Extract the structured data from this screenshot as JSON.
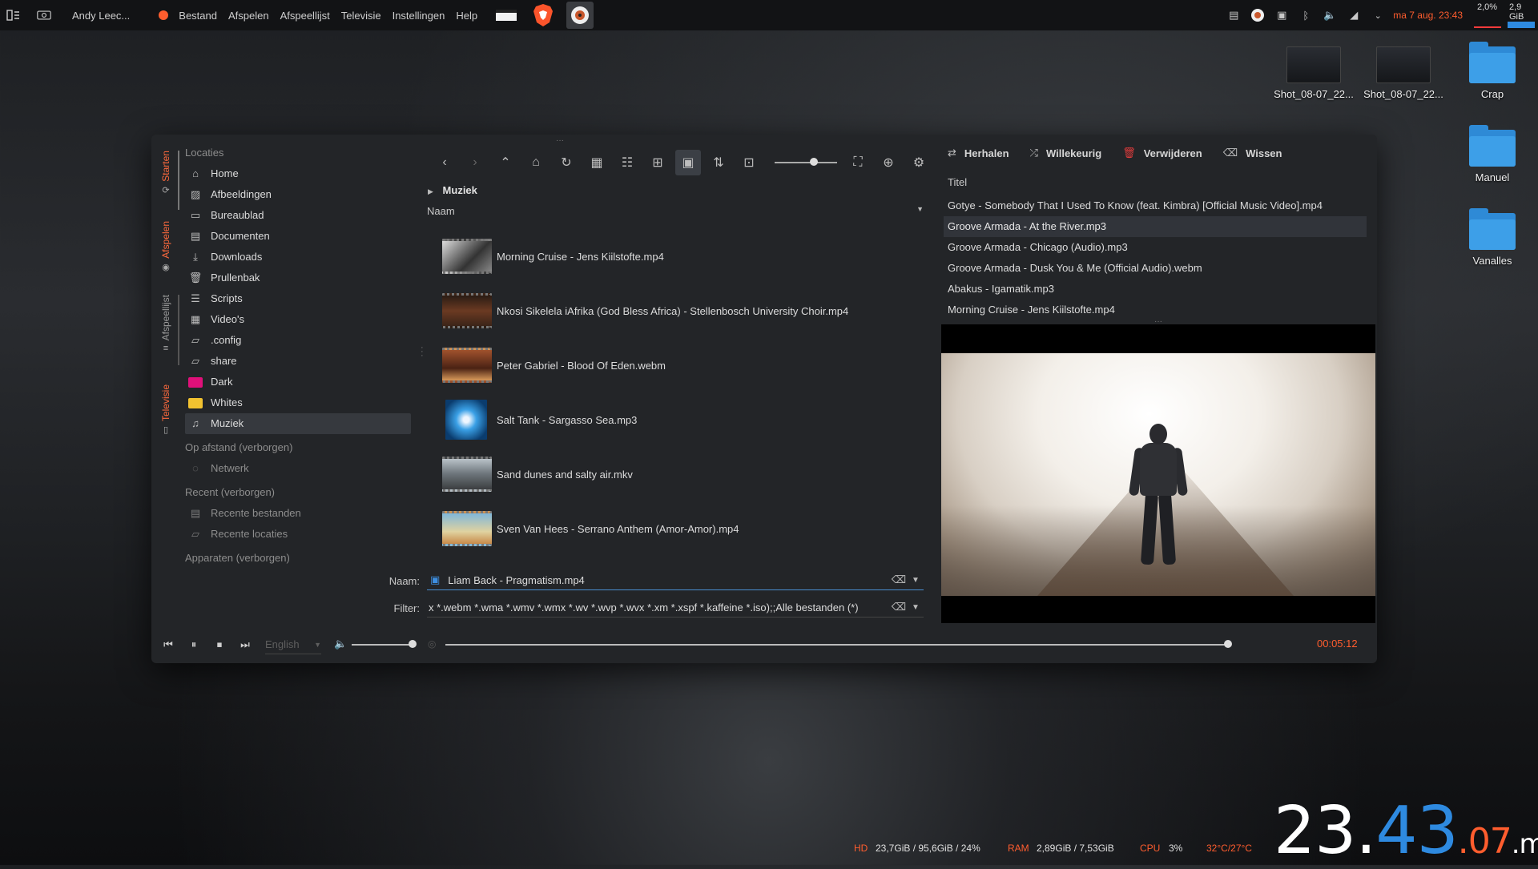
{
  "panel": {
    "user": "Andy Leec...",
    "menus": [
      "Bestand",
      "Afspelen",
      "Afspeellijst",
      "Televisie",
      "Instellingen",
      "Help"
    ],
    "datetime": "ma 7 aug. 23:43",
    "cpu_load": "2,0%",
    "mem_load": "2,9 GiB",
    "accent": "#ff5d2e"
  },
  "desktop": {
    "icons": [
      {
        "label": "Shot_08-07_22...",
        "type": "image"
      },
      {
        "label": "Shot_08-07_22...",
        "type": "image"
      },
      {
        "label": "Crap",
        "type": "folder"
      },
      {
        "label": "Manuel",
        "type": "folder"
      },
      {
        "label": "Vanalles",
        "type": "folder"
      }
    ]
  },
  "sidebar_tabs": [
    "Starten",
    "Afspelen",
    "Afspeellijst",
    "Televisie"
  ],
  "places": {
    "header": "Locaties",
    "items": [
      {
        "label": "Home",
        "icon": "home-icon"
      },
      {
        "label": "Afbeeldingen",
        "icon": "image-folder-icon"
      },
      {
        "label": "Bureaublad",
        "icon": "desktop-icon"
      },
      {
        "label": "Documenten",
        "icon": "document-icon"
      },
      {
        "label": "Downloads",
        "icon": "download-icon"
      },
      {
        "label": "Prullenbak",
        "icon": "trash-icon"
      },
      {
        "label": "Scripts",
        "icon": "script-icon"
      },
      {
        "label": "Video's",
        "icon": "video-icon"
      },
      {
        "label": ".config",
        "icon": "folder-icon"
      },
      {
        "label": "share",
        "icon": "folder-icon"
      },
      {
        "label": "Dark",
        "icon": "magenta-folder-icon"
      },
      {
        "label": "Whites",
        "icon": "yellow-folder-icon"
      },
      {
        "label": "Muziek",
        "icon": "music-icon",
        "selected": true
      }
    ],
    "remote_header": "Op afstand (verborgen)",
    "network": "Netwerk",
    "recent_header": "Recent (verborgen)",
    "recent_files": "Recente bestanden",
    "recent_locations": "Recente locaties",
    "devices_header": "Apparaten (verborgen)"
  },
  "browser": {
    "breadcrumb": "Muziek",
    "column": "Naam",
    "files": [
      "Morning Cruise - Jens Kiilstofte.mp4",
      "Nkosi Sikelela iAfrika (God Bless Africa) - Stellenbosch University Choir.mp4",
      "Peter Gabriel - Blood Of Eden.webm",
      "Salt Tank - Sargasso Sea.mp3",
      "Sand dunes and salty air.mkv",
      "Sven Van Hees - Serrano Anthem (Amor-Amor).mp4"
    ],
    "name_label": "Naam:",
    "name_value": "Liam Back - Pragmatism.mp4",
    "filter_label": "Filter:",
    "filter_value": "x *.webm *.wma *.wmv *.wmx *.wv *.wvp *.wvx *.xm *.xspf *.kaffeine *.iso);;Alle bestanden (*)"
  },
  "playlist": {
    "repeat": "Herhalen",
    "shuffle": "Willekeurig",
    "remove": "Verwijderen",
    "clear": "Wissen",
    "column": "Titel",
    "items": [
      "Gotye - Somebody That I Used To Know (feat. Kimbra) [Official Music Video].mp4",
      "Groove Armada - At the River.mp3",
      "Groove Armada - Chicago (Audio).mp3",
      "Groove Armada - Dusk You & Me (Official Audio).webm",
      "Abakus - Igamatik.mp3",
      "Morning Cruise - Jens Kiilstofte.mp4"
    ],
    "selected_index": 1
  },
  "transport": {
    "language": "English",
    "volume": 1.0,
    "position": 0.97,
    "time": "00:05:12"
  },
  "status": {
    "hd_label": "HD",
    "hd_value": "23,7GiB / 95,6GiB / 24%",
    "ram_label": "RAM",
    "ram_value": "2,89GiB / 7,53GiB",
    "cpu_label": "CPU",
    "cpu_value": "3%",
    "temp": "32°C/27°C"
  },
  "clock": {
    "hours": "23.",
    "minutes": "43",
    "seconds": ".07",
    "day": ".ma"
  }
}
